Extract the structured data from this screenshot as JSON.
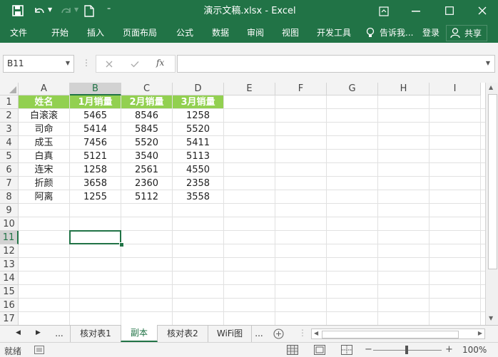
{
  "window": {
    "title": "演示文稿.xlsx - Excel",
    "accent": "#217346"
  },
  "ribbon": {
    "tabs": [
      "文件",
      "开始",
      "插入",
      "页面布局",
      "公式",
      "数据",
      "审阅",
      "视图",
      "开发工具"
    ],
    "tell_me": "告诉我...",
    "login": "登录",
    "share": "共享"
  },
  "formula_bar": {
    "name_box": "B11",
    "fx_label": "fx",
    "formula_value": ""
  },
  "grid": {
    "columns": [
      "A",
      "B",
      "C",
      "D",
      "E",
      "F",
      "G",
      "H",
      "I"
    ],
    "rows": [
      "1",
      "2",
      "3",
      "4",
      "5",
      "6",
      "7",
      "8",
      "9",
      "10",
      "11",
      "12",
      "13",
      "14",
      "15",
      "16",
      "17"
    ],
    "header_fill": "#92d050",
    "headers": [
      "姓名",
      "1月销量",
      "2月销量",
      "3月销量"
    ],
    "data": [
      [
        "白滚滚",
        "5465",
        "8546",
        "1258"
      ],
      [
        "司命",
        "5414",
        "5845",
        "5520"
      ],
      [
        "成玉",
        "7456",
        "5520",
        "5411"
      ],
      [
        "白真",
        "5121",
        "3540",
        "5113"
      ],
      [
        "连宋",
        "1258",
        "2561",
        "4550"
      ],
      [
        "折颜",
        "3658",
        "2360",
        "2358"
      ],
      [
        "阿离",
        "1255",
        "5112",
        "3558"
      ]
    ]
  },
  "sheets": {
    "ellipsis": "...",
    "tabs": [
      "核对表1",
      "副本",
      "核对表2",
      "WiFi图"
    ],
    "active": "副本"
  },
  "status": {
    "ready": "就绪",
    "zoom": "100%"
  }
}
